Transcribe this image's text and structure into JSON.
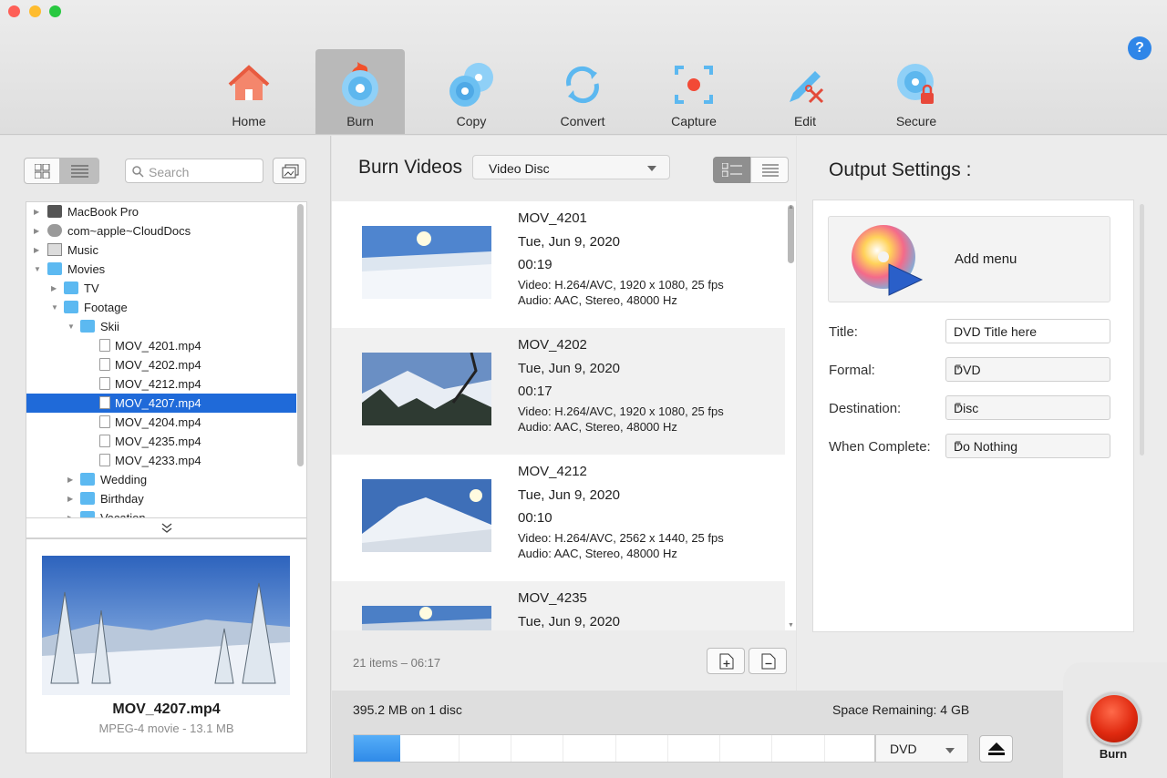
{
  "toolbar": {
    "items": [
      {
        "label": "Home",
        "icon": "home-icon"
      },
      {
        "label": "Burn",
        "icon": "burn-disc-icon"
      },
      {
        "label": "Copy",
        "icon": "copy-disc-icon"
      },
      {
        "label": "Convert",
        "icon": "convert-icon"
      },
      {
        "label": "Capture",
        "icon": "capture-icon"
      },
      {
        "label": "Edit",
        "icon": "edit-icon"
      },
      {
        "label": "Secure",
        "icon": "secure-disc-icon"
      }
    ],
    "active": "Burn",
    "help": "?"
  },
  "browser": {
    "search_placeholder": "Search",
    "tree": [
      {
        "label": "MacBook Pro",
        "icon": "laptop-icon"
      },
      {
        "label": "com~apple~CloudDocs",
        "icon": "cloud-icon"
      },
      {
        "label": "Music",
        "icon": "music-icon"
      },
      {
        "label": "Movies",
        "icon": "movies-folder-icon"
      },
      {
        "label": "TV",
        "icon": "folder-icon"
      },
      {
        "label": "Footage",
        "icon": "folder-icon"
      },
      {
        "label": "Skii",
        "icon": "folder-icon"
      },
      {
        "label": "MOV_4201.mp4",
        "icon": "video-file-icon"
      },
      {
        "label": "MOV_4202.mp4",
        "icon": "video-file-icon"
      },
      {
        "label": "MOV_4212.mp4",
        "icon": "video-file-icon"
      },
      {
        "label": "MOV_4207.mp4",
        "icon": "video-file-icon"
      },
      {
        "label": "MOV_4204.mp4",
        "icon": "video-file-icon"
      },
      {
        "label": "MOV_4235.mp4",
        "icon": "video-file-icon"
      },
      {
        "label": "MOV_4233.mp4",
        "icon": "video-file-icon"
      },
      {
        "label": "Wedding",
        "icon": "folder-icon"
      },
      {
        "label": "Birthday",
        "icon": "folder-icon"
      },
      {
        "label": "Vacation",
        "icon": "folder-icon"
      }
    ],
    "selected": "MOV_4207.mp4",
    "preview": {
      "name": "MOV_4207.mp4",
      "meta": "MPEG-4 movie - 13.1 MB"
    }
  },
  "burn": {
    "title": "Burn Videos",
    "disc_type": "Video Disc",
    "items": [
      {
        "name": "MOV_4201",
        "date": "Tue, Jun 9, 2020",
        "duration": "00:19",
        "video": "Video: H.264/AVC, 1920 x 1080, 25 fps",
        "audio": "Audio: AAC, Stereo, 48000 Hz"
      },
      {
        "name": "MOV_4202",
        "date": "Tue, Jun 9, 2020",
        "duration": "00:17",
        "video": "Video: H.264/AVC, 1920 x 1080, 25 fps",
        "audio": "Audio: AAC, Stereo, 48000 Hz"
      },
      {
        "name": "MOV_4212",
        "date": "Tue, Jun 9, 2020",
        "duration": "00:10",
        "video": "Video: H.264/AVC, 2562 x 1440,  25 fps",
        "audio": "Audio: AAC, Stereo, 48000 Hz"
      },
      {
        "name": "MOV_4235",
        "date": "Tue, Jun 9, 2020",
        "duration": "",
        "video": "",
        "audio": ""
      }
    ],
    "count": "21 items – 06:17"
  },
  "output": {
    "title": "Output Settings :",
    "add_menu": "Add menu",
    "fields": [
      {
        "label": "Title:",
        "value": "DVD Title here"
      },
      {
        "label": "Formal:",
        "value": "DVD"
      },
      {
        "label": "Destination:",
        "value": "Disc"
      },
      {
        "label": "When Complete:",
        "value": "Do Nothing"
      }
    ]
  },
  "status": {
    "size": "395.2 MB on 1 disc",
    "space": "Space Remaining: 4 GB",
    "progress_fraction": 0.09,
    "media": "DVD",
    "burn_label": "Burn"
  },
  "colors": {
    "accent": "#1f6ad9",
    "burn": "#e02a10",
    "progress": "#2f8ae8"
  }
}
